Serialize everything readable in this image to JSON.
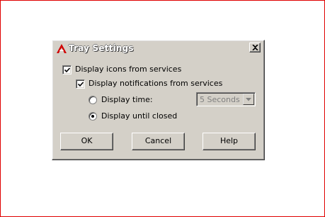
{
  "dialog": {
    "title": "Tray Settings",
    "title_icon": "autocad-a-icon",
    "close_icon": "close-icon"
  },
  "options": {
    "display_icons": {
      "label": "Display icons from services",
      "checked": true
    },
    "display_notifications": {
      "label": "Display notifications from services",
      "checked": true
    },
    "display_time": {
      "label": "Display time:",
      "selected": false
    },
    "display_until_closed": {
      "label": "Display until closed",
      "selected": true
    },
    "time_select": {
      "value": "5 Seconds",
      "disabled": true
    }
  },
  "buttons": {
    "ok": "OK",
    "cancel": "Cancel",
    "help": "Help"
  },
  "colors": {
    "frame_border": "#e00000",
    "dialog_face": "#d4d0c8",
    "disabled_text": "#808080"
  }
}
